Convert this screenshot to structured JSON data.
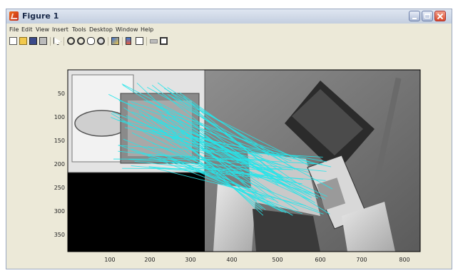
{
  "window": {
    "title": "Figure 1"
  },
  "menu": [
    "File",
    "Edit",
    "View",
    "Insert",
    "Tools",
    "Desktop",
    "Window",
    "Help"
  ],
  "toolbar_icons": [
    "new-figure-icon",
    "open-file-icon",
    "save-icon",
    "print-icon",
    "select-arrow-icon",
    "zoom-in-icon",
    "zoom-out-icon",
    "pan-icon",
    "rotate-3d-icon",
    "data-cursor-icon",
    "colorbar-icon",
    "legend-icon",
    "hide-plot-tools-icon",
    "show-plot-tools-icon"
  ],
  "axes": {
    "x_ticks": [
      "100",
      "200",
      "300",
      "400",
      "500",
      "600",
      "700",
      "800"
    ],
    "y_ticks": [
      "50",
      "100",
      "150",
      "200",
      "250",
      "300",
      "350"
    ],
    "xlim": [
      1,
      870
    ],
    "ylim": [
      1,
      385
    ]
  },
  "colors": {
    "match_line": "#26e5ea",
    "window_bg": "#ece9d8"
  }
}
